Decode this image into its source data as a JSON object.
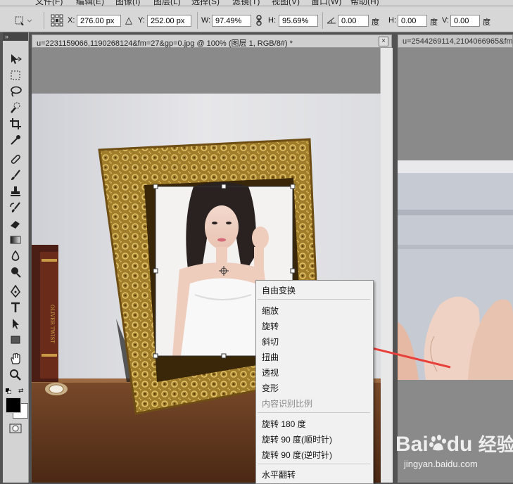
{
  "menubar": {
    "items": [
      "文件(F)",
      "编辑(E)",
      "图像(I)",
      "图层(L)",
      "选择(S)",
      "滤镜(T)",
      "视图(V)",
      "窗口(W)",
      "帮助(H)"
    ]
  },
  "options": {
    "x_label": "X:",
    "x_value": "276.00 px",
    "y_label": "Y:",
    "y_value": "252.00 px",
    "w_label": "W:",
    "w_value": "97.49%",
    "h_label": "H:",
    "h_value": "95.69%",
    "rotate_value": "0.00",
    "rotate_unit": "度",
    "hskew_label": "H:",
    "hskew_value": "0.00",
    "hskew_unit": "度",
    "vskew_label": "V:",
    "vskew_value": "0.00",
    "vskew_unit": "度"
  },
  "toolbox": {
    "grip": "»",
    "tools": [
      "move-icon",
      "marquee-icon",
      "lasso-icon",
      "quick-select-icon",
      "crop-icon",
      "eyedropper-icon",
      "healing-icon",
      "brush-icon",
      "stamp-icon",
      "history-brush-icon",
      "eraser-icon",
      "gradient-icon",
      "blur-icon",
      "dodge-icon",
      "pen-icon",
      "type-icon",
      "path-select-icon",
      "shape-icon",
      "hand-icon",
      "zoom-icon"
    ]
  },
  "doc1": {
    "tab_title": "u=2231159066,1190268124&fm=27&gp=0.jpg @ 100% (图层 1, RGB/8#) *",
    "close": "×"
  },
  "doc2": {
    "tab_title": "u=2544269114,2104066965&fm"
  },
  "context_menu": {
    "items": [
      {
        "label": "自由变换",
        "enabled": true
      },
      {
        "label": "缩放",
        "enabled": true
      },
      {
        "label": "旋转",
        "enabled": true
      },
      {
        "label": "斜切",
        "enabled": true
      },
      {
        "label": "扭曲",
        "enabled": true
      },
      {
        "label": "透视",
        "enabled": true
      },
      {
        "label": "变形",
        "enabled": true
      },
      {
        "label": "内容识别比例",
        "enabled": false
      },
      {
        "label": "旋转 180 度",
        "enabled": true
      },
      {
        "label": "旋转 90 度(顺时针)",
        "enabled": true
      },
      {
        "label": "旋转 90 度(逆时针)",
        "enabled": true
      },
      {
        "label": "水平翻转",
        "enabled": true
      }
    ]
  },
  "watermark": {
    "brand": "Bai",
    "brand2": "du",
    "product": "经验",
    "url": "jingyan.baidu.com"
  },
  "colors": {
    "annotation_arrow": "#e8403a",
    "menu_bg": "#f1f1f1",
    "frame_gold": "#b8922e"
  }
}
